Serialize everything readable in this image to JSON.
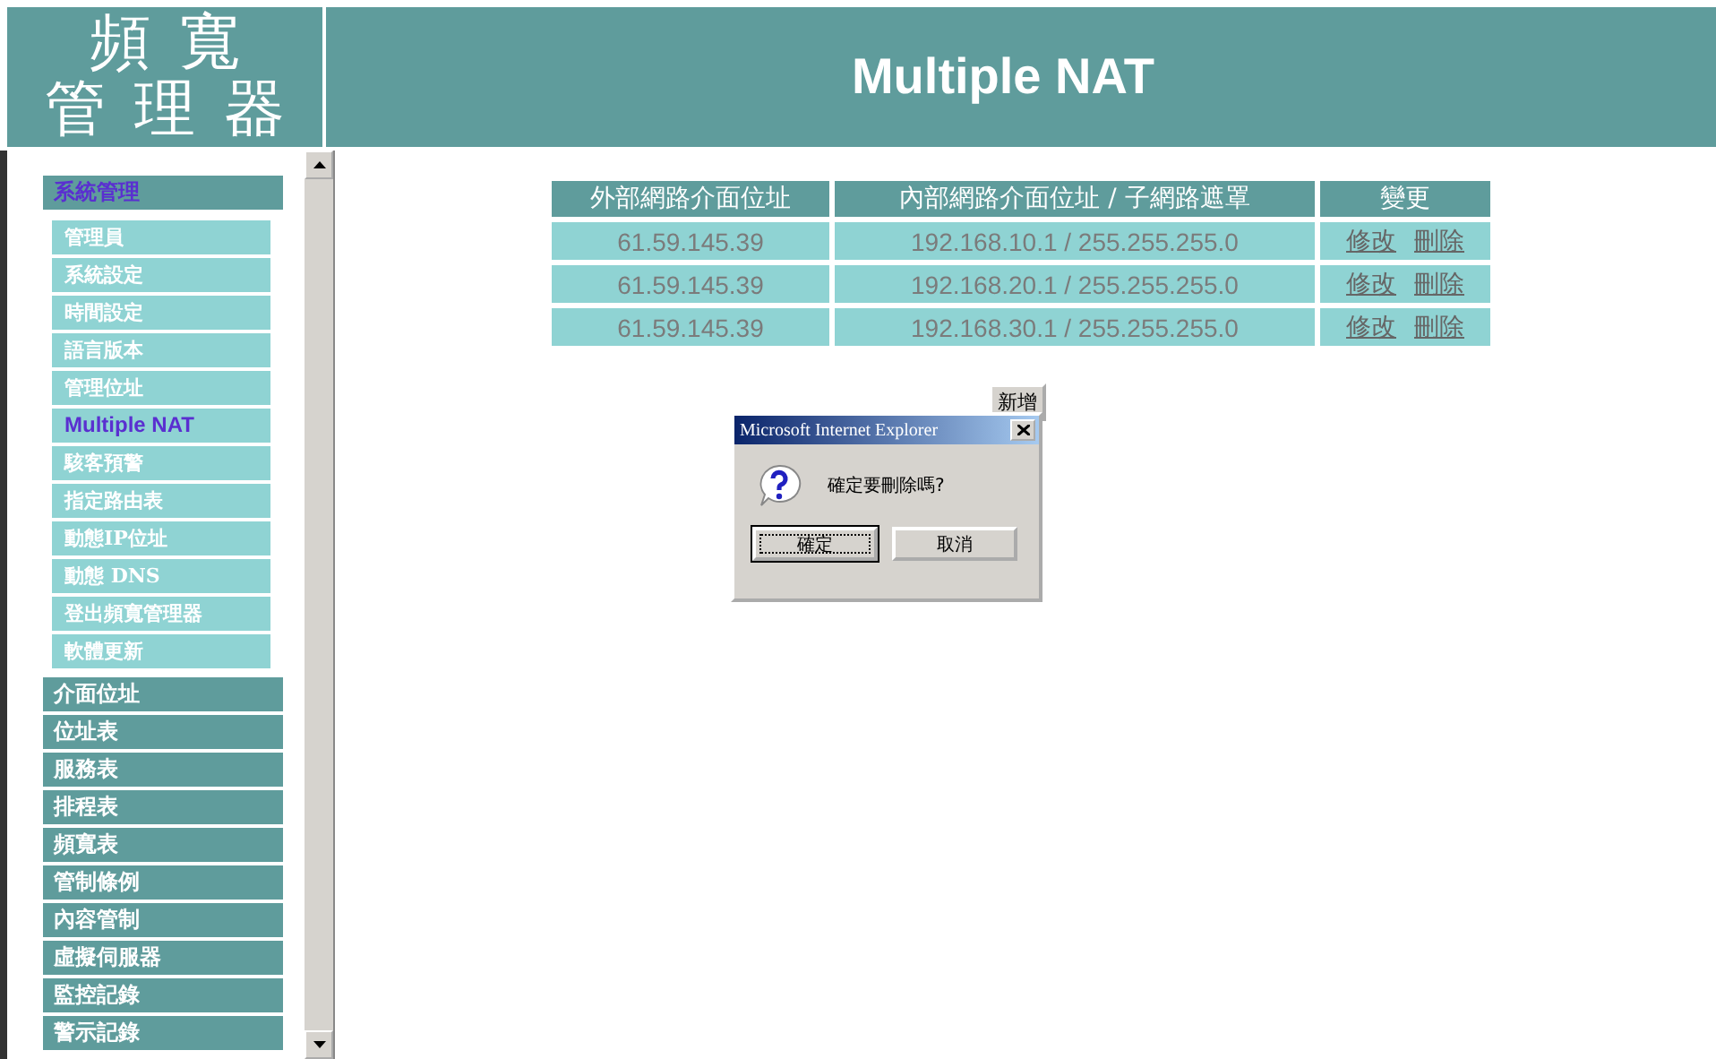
{
  "header": {
    "logo_lines": [
      "頻寬",
      "管理器"
    ],
    "title": "Multiple NAT"
  },
  "sidebar": {
    "groups": [
      {
        "label": "系統管理",
        "expanded": true,
        "children": [
          {
            "label": "管理員",
            "selected": false
          },
          {
            "label": "系統設定",
            "selected": false
          },
          {
            "label": "時間設定",
            "selected": false
          },
          {
            "label": "語言版本",
            "selected": false
          },
          {
            "label": "管理位址",
            "selected": false
          },
          {
            "label": "Multiple NAT",
            "selected": true
          },
          {
            "label": "駭客預警",
            "selected": false
          },
          {
            "label": "指定路由表",
            "selected": false
          },
          {
            "label": "動態IP位址",
            "selected": false
          },
          {
            "label": "動態 DNS",
            "selected": false
          },
          {
            "label": "登出頻寬管理器",
            "selected": false
          },
          {
            "label": "軟體更新",
            "selected": false
          }
        ]
      },
      {
        "label": "介面位址",
        "expanded": false
      },
      {
        "label": "位址表",
        "expanded": false
      },
      {
        "label": "服務表",
        "expanded": false
      },
      {
        "label": "排程表",
        "expanded": false
      },
      {
        "label": "頻寬表",
        "expanded": false
      },
      {
        "label": "管制條例",
        "expanded": false
      },
      {
        "label": "內容管制",
        "expanded": false
      },
      {
        "label": "虛擬伺服器",
        "expanded": false
      },
      {
        "label": "監控記錄",
        "expanded": false
      },
      {
        "label": "警示記錄",
        "expanded": false
      }
    ]
  },
  "table": {
    "columns": [
      "外部網路介面位址",
      "內部網路介面位址 / 子網路遮罩",
      "變更"
    ],
    "rows": [
      {
        "external": "61.59.145.39",
        "internal": "192.168.10.1 / 255.255.255.0",
        "actions": [
          "修改",
          "刪除"
        ]
      },
      {
        "external": "61.59.145.39",
        "internal": "192.168.20.1 / 255.255.255.0",
        "actions": [
          "修改",
          "刪除"
        ]
      },
      {
        "external": "61.59.145.39",
        "internal": "192.168.30.1 / 255.255.255.0",
        "actions": [
          "修改",
          "刪除"
        ]
      }
    ]
  },
  "add_button": "新增",
  "dialog": {
    "title": "Microsoft Internet Explorer",
    "message": "確定要刪除嗎?",
    "buttons": [
      {
        "label": "確定",
        "focused": true
      },
      {
        "label": "取消",
        "focused": false
      }
    ]
  }
}
